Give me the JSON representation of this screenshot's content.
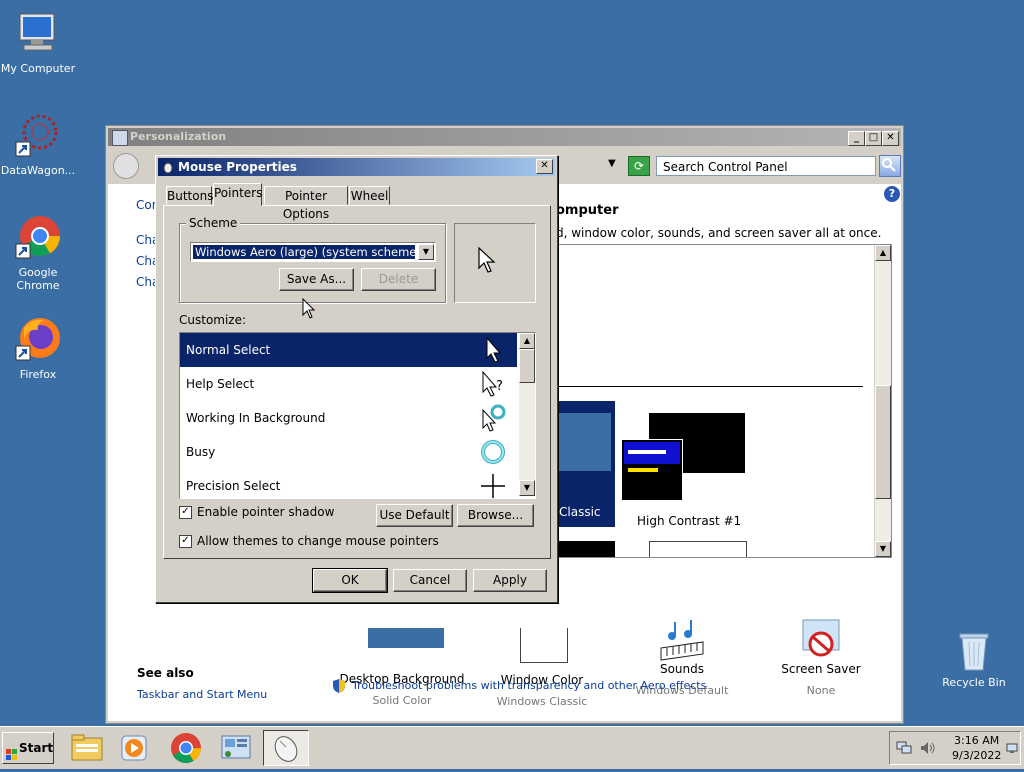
{
  "desktop": {
    "icons": [
      {
        "label": "My Computer"
      },
      {
        "label": "DataWagon..."
      },
      {
        "label": "Google Chrome"
      },
      {
        "label": "Firefox"
      },
      {
        "label": "Recycle Bin"
      }
    ]
  },
  "personalization": {
    "title": "Personalization",
    "search_placeholder": "Search Control Panel",
    "sidebar": {
      "partial_link_1": "Con",
      "partial_link_2": "Cha",
      "partial_link_3": "Cha",
      "partial_link_4": "Cha"
    },
    "heading_partial": "omputer",
    "desc_partial": "d, window color, sounds, and screen saver all at once.",
    "themes": [
      {
        "label": "Classic",
        "partial": true
      },
      {
        "label": "High Contrast #1"
      }
    ],
    "bottom_items": [
      {
        "label": "Desktop Background",
        "sub": "Solid Color"
      },
      {
        "label": "Window Color",
        "sub": "Windows Classic"
      },
      {
        "label": "Sounds",
        "sub": "Windows Default"
      },
      {
        "label": "Screen Saver",
        "sub": "None"
      }
    ],
    "see_also": "See also",
    "see_also_link": "Taskbar and Start Menu",
    "troubleshoot": "Troubleshoot problems with transparency and other Aero effects"
  },
  "mouse_dialog": {
    "title": "Mouse Properties",
    "tabs": [
      {
        "label": "Buttons"
      },
      {
        "label": "Pointers"
      },
      {
        "label": "Pointer Options"
      },
      {
        "label": "Wheel"
      }
    ],
    "scheme_label": "Scheme",
    "scheme_value": "Windows Aero (large) (system scheme)",
    "save_as": "Save As...",
    "delete": "Delete",
    "customize_label": "Customize:",
    "pointers": [
      {
        "label": "Normal Select"
      },
      {
        "label": "Help Select"
      },
      {
        "label": "Working In Background"
      },
      {
        "label": "Busy"
      },
      {
        "label": "Precision Select"
      }
    ],
    "enable_shadow": "Enable pointer shadow",
    "use_default": "Use Default",
    "browse": "Browse...",
    "allow_themes": "Allow themes to change mouse pointers",
    "ok": "OK",
    "cancel": "Cancel",
    "apply": "Apply"
  },
  "taskbar": {
    "start": "Start",
    "time": "3:16 AM",
    "date": "9/3/2022"
  },
  "colors": {
    "desktop": "#3a6ea5",
    "title_active": "#0a246a",
    "selection": "#0a246a",
    "link": "#0a3c9c"
  }
}
